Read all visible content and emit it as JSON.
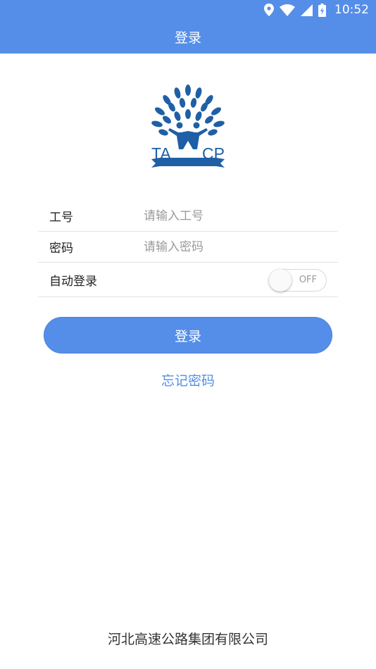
{
  "status_bar": {
    "time": "10:52",
    "icons": [
      "location-icon",
      "wifi-icon",
      "signal-icon",
      "battery-icon"
    ],
    "background": "#558ee8"
  },
  "app_bar": {
    "title": "登录"
  },
  "logo": {
    "text_left": "TA",
    "text_right": "CP",
    "color": "#1e5fa6"
  },
  "form": {
    "employee_id": {
      "label": "工号",
      "placeholder": "请输入工号",
      "value": ""
    },
    "password": {
      "label": "密码",
      "placeholder": "请输入密码",
      "value": ""
    },
    "auto_login": {
      "label": "自动登录",
      "state_text": "OFF",
      "on": false
    }
  },
  "login_button": {
    "label": "登录",
    "color": "#558ee8"
  },
  "forgot_password": {
    "label": "忘记密码"
  },
  "footer": {
    "text": "河北高速公路集团有限公司"
  }
}
